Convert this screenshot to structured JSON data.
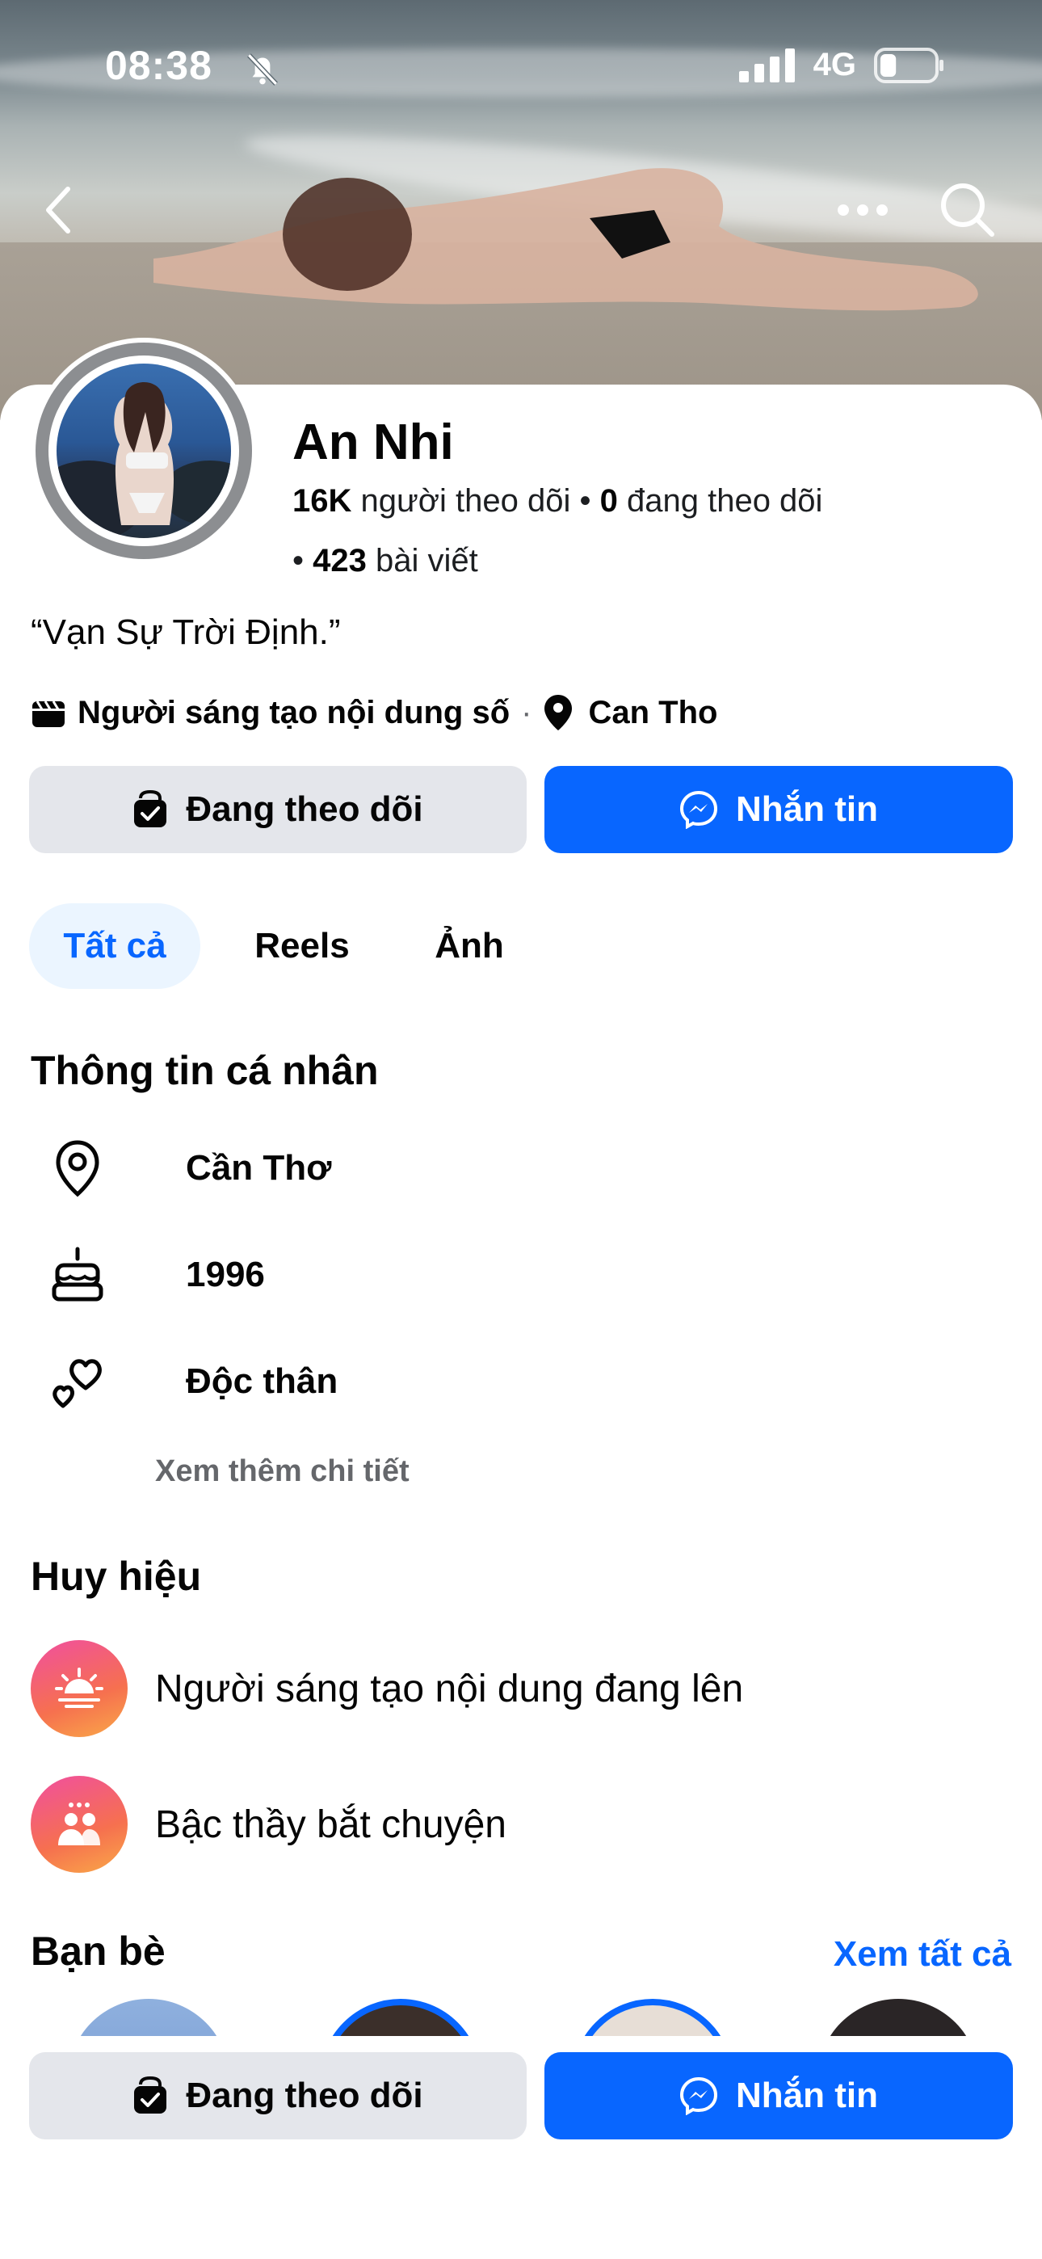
{
  "status_bar": {
    "time": "08:38",
    "network": "4G",
    "battery_percent": 30
  },
  "profile": {
    "name": "An Nhi",
    "followers_count": "16K",
    "followers_label": "người theo dõi",
    "following_count": "0",
    "following_label": "đang theo dõi",
    "posts_count": "423",
    "posts_label": "bài viết",
    "bio": "“Vạn Sự Trời Định.”",
    "category": "Người sáng tạo nội dung số",
    "location": "Can Tho"
  },
  "actions": {
    "following_label": "Đang theo dõi",
    "message_label": "Nhắn tin"
  },
  "tabs": [
    {
      "label": "Tất cả",
      "active": true
    },
    {
      "label": "Reels",
      "active": false
    },
    {
      "label": "Ảnh",
      "active": false
    }
  ],
  "personal_info": {
    "title": "Thông tin cá nhân",
    "items": [
      {
        "icon": "location-pin-icon",
        "text": "Cần Thơ"
      },
      {
        "icon": "birthday-cake-icon",
        "text": "1996"
      },
      {
        "icon": "hearts-icon",
        "text": "Độc thân"
      }
    ],
    "see_more": "Xem thêm chi tiết"
  },
  "badges": {
    "title": "Huy hiệu",
    "items": [
      {
        "icon": "sunrise-icon",
        "text": "Người sáng tạo nội dung đang lên"
      },
      {
        "icon": "people-chat-icon",
        "text": "Bậc thầy bắt chuyện"
      }
    ]
  },
  "friends": {
    "title": "Bạn bè",
    "see_all": "Xem tất cả"
  },
  "colors": {
    "accent": "#0866ff",
    "button_gray": "#e4e6eb",
    "tab_active_bg": "#ebf5ff",
    "muted_text": "#65676b"
  }
}
